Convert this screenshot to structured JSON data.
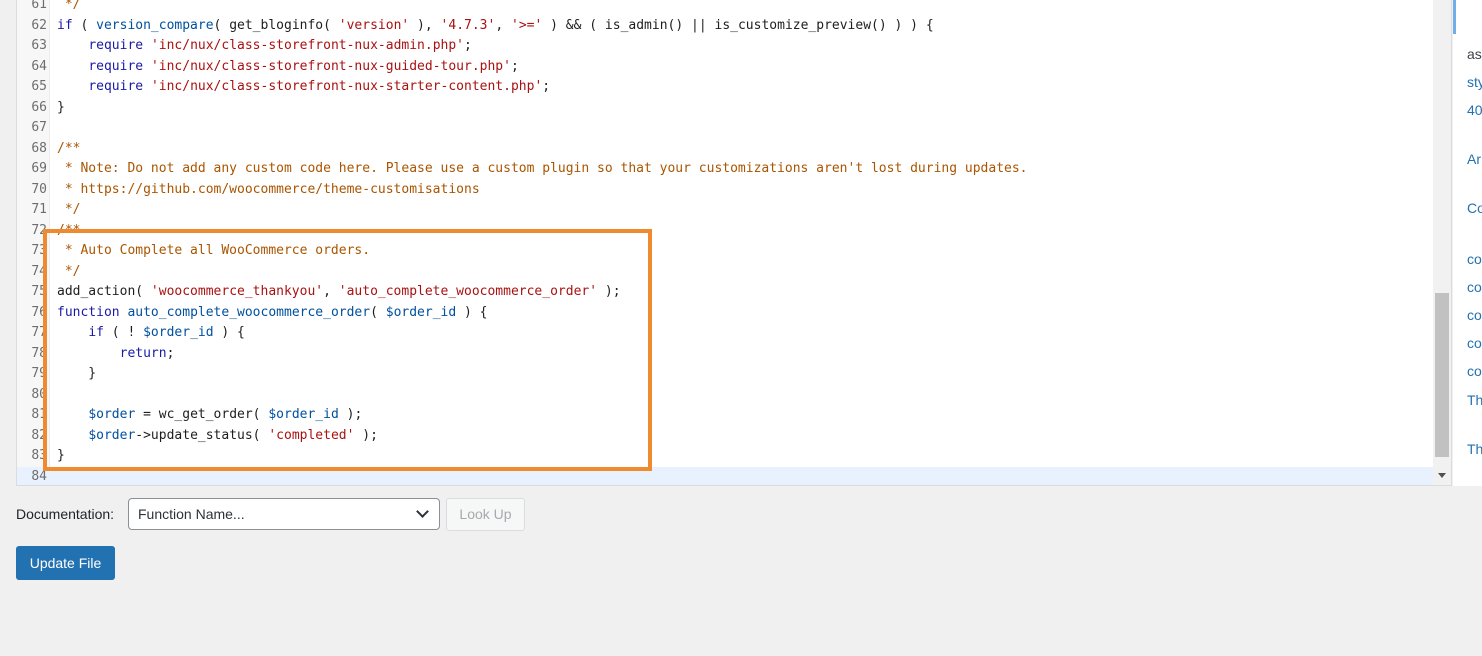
{
  "editor": {
    "lines": [
      {
        "num": "61",
        "tokens": [
          {
            "t": " */",
            "c": "c"
          }
        ]
      },
      {
        "num": "62",
        "tokens": [
          {
            "t": "if",
            "c": "k"
          },
          {
            "t": " ( "
          },
          {
            "t": "version_compare",
            "c": "v"
          },
          {
            "t": "( get_bloginfo( "
          },
          {
            "t": "'version'",
            "c": "s"
          },
          {
            "t": " ), "
          },
          {
            "t": "'4.7.3'",
            "c": "s"
          },
          {
            "t": ", "
          },
          {
            "t": "'>='",
            "c": "s"
          },
          {
            "t": " ) && ( is_admin() || is_customize_preview() ) ) {"
          }
        ]
      },
      {
        "num": "63",
        "tokens": [
          {
            "t": "    "
          },
          {
            "t": "require",
            "c": "k"
          },
          {
            "t": " "
          },
          {
            "t": "'inc/nux/class-storefront-nux-admin.php'",
            "c": "s"
          },
          {
            "t": ";"
          }
        ]
      },
      {
        "num": "64",
        "tokens": [
          {
            "t": "    "
          },
          {
            "t": "require",
            "c": "k"
          },
          {
            "t": " "
          },
          {
            "t": "'inc/nux/class-storefront-nux-guided-tour.php'",
            "c": "s"
          },
          {
            "t": ";"
          }
        ]
      },
      {
        "num": "65",
        "tokens": [
          {
            "t": "    "
          },
          {
            "t": "require",
            "c": "k"
          },
          {
            "t": " "
          },
          {
            "t": "'inc/nux/class-storefront-nux-starter-content.php'",
            "c": "s"
          },
          {
            "t": ";"
          }
        ]
      },
      {
        "num": "66",
        "tokens": [
          {
            "t": "}"
          }
        ]
      },
      {
        "num": "67",
        "tokens": []
      },
      {
        "num": "68",
        "tokens": [
          {
            "t": "/**",
            "c": "c"
          }
        ]
      },
      {
        "num": "69",
        "tokens": [
          {
            "t": " * Note: Do not add any custom code here. Please use a custom plugin so that your customizations aren't lost during updates.",
            "c": "c"
          }
        ]
      },
      {
        "num": "70",
        "tokens": [
          {
            "t": " * https://github.com/woocommerce/theme-customisations",
            "c": "c"
          }
        ]
      },
      {
        "num": "71",
        "tokens": [
          {
            "t": " */",
            "c": "c"
          }
        ]
      },
      {
        "num": "72",
        "tokens": [
          {
            "t": "/**",
            "c": "c"
          }
        ]
      },
      {
        "num": "73",
        "tokens": [
          {
            "t": " * Auto Complete all WooCommerce orders.",
            "c": "c"
          }
        ]
      },
      {
        "num": "74",
        "tokens": [
          {
            "t": " */",
            "c": "c"
          }
        ]
      },
      {
        "num": "75",
        "tokens": [
          {
            "t": "add_action( "
          },
          {
            "t": "'woocommerce_thankyou'",
            "c": "s"
          },
          {
            "t": ", "
          },
          {
            "t": "'auto_complete_woocommerce_order'",
            "c": "s"
          },
          {
            "t": " );"
          }
        ]
      },
      {
        "num": "76",
        "tokens": [
          {
            "t": "function",
            "c": "k"
          },
          {
            "t": " "
          },
          {
            "t": "auto_complete_woocommerce_order",
            "c": "v"
          },
          {
            "t": "( "
          },
          {
            "t": "$order_id",
            "c": "v"
          },
          {
            "t": " ) {"
          }
        ]
      },
      {
        "num": "77",
        "tokens": [
          {
            "t": "    "
          },
          {
            "t": "if",
            "c": "k"
          },
          {
            "t": " ( ! "
          },
          {
            "t": "$order_id",
            "c": "v"
          },
          {
            "t": " ) {"
          }
        ]
      },
      {
        "num": "78",
        "tokens": [
          {
            "t": "        "
          },
          {
            "t": "return",
            "c": "k"
          },
          {
            "t": ";"
          }
        ]
      },
      {
        "num": "79",
        "tokens": [
          {
            "t": "    }"
          }
        ]
      },
      {
        "num": "80",
        "tokens": []
      },
      {
        "num": "81",
        "tokens": [
          {
            "t": "    "
          },
          {
            "t": "$order",
            "c": "v"
          },
          {
            "t": " = wc_get_order( "
          },
          {
            "t": "$order_id",
            "c": "v"
          },
          {
            "t": " );"
          }
        ]
      },
      {
        "num": "82",
        "tokens": [
          {
            "t": "    "
          },
          {
            "t": "$order",
            "c": "v"
          },
          {
            "t": "->update_status( "
          },
          {
            "t": "'completed'",
            "c": "s"
          },
          {
            "t": " );"
          }
        ]
      },
      {
        "num": "83",
        "tokens": [
          {
            "t": "}"
          }
        ]
      },
      {
        "num": "84",
        "tokens": []
      }
    ]
  },
  "side_panel": {
    "items": [
      {
        "label": "as",
        "style": "dark"
      },
      {
        "label": "sty",
        "style": "link"
      },
      {
        "label": "40",
        "style": "link"
      },
      {
        "label": "Ar",
        "style": "link"
      },
      {
        "label": "Co",
        "style": "link"
      },
      {
        "label": "co",
        "style": "link"
      },
      {
        "label": "co",
        "style": "link"
      },
      {
        "label": "co",
        "style": "link"
      },
      {
        "label": "co",
        "style": "link"
      },
      {
        "label": "co",
        "style": "link"
      },
      {
        "label": "Th",
        "style": "link"
      },
      {
        "label": "Th",
        "style": "link"
      }
    ]
  },
  "documentation": {
    "label": "Documentation:",
    "select_value": "Function Name...",
    "lookup_label": "Look Up"
  },
  "update_button_label": "Update File",
  "colors": {
    "primary_button": "#2271b1",
    "highlight_border": "#f08a2e",
    "keyword": "#1a1aa6",
    "string": "#aa1111",
    "comment": "#aa5500",
    "variable": "#0050a0"
  }
}
